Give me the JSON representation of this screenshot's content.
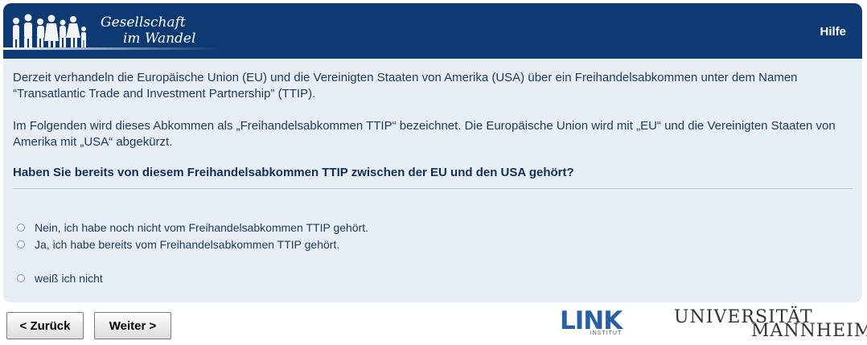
{
  "header": {
    "logo_line1": "Gesellschaft",
    "logo_line2": "im Wandel",
    "help": "Hilfe"
  },
  "content": {
    "intro": "Derzeit verhandeln die Europäische Union (EU) und die Vereinigten Staaten von Amerika (USA) über ein Freihandelsabkommen unter dem Namen “Transatlantic Trade and Investment Partnership” (TTIP).",
    "note": "Im Folgenden wird dieses Abkommen als „Freihandelsabkommen TTIP“ bezeichnet. Die Europäische Union wird mit „EU“ und die Vereinigten Staaten von Amerika mit „USA“ abgekürzt.",
    "question": "Haben Sie bereits von diesem Freihandelsabkommen TTIP zwischen der EU und den USA gehört?"
  },
  "options": [
    "Nein, ich habe noch nicht vom Freihandelsabkommen TTIP gehört.",
    "Ja, ich habe bereits vom Freihandelsabkommen TTIP gehört.",
    "weiß ich nicht"
  ],
  "nav": {
    "back": "< Zurück",
    "next": "Weiter >"
  },
  "logos": {
    "link": "LINK",
    "link_sub": "INSTITUT",
    "uni_line1": "UNIVERSITÄT",
    "uni_line2": "MANNHEIM"
  },
  "colors": {
    "header_bg": "#0e3a74",
    "panel_bg": "#e8eef6",
    "link_blue": "#2a5fa8"
  }
}
